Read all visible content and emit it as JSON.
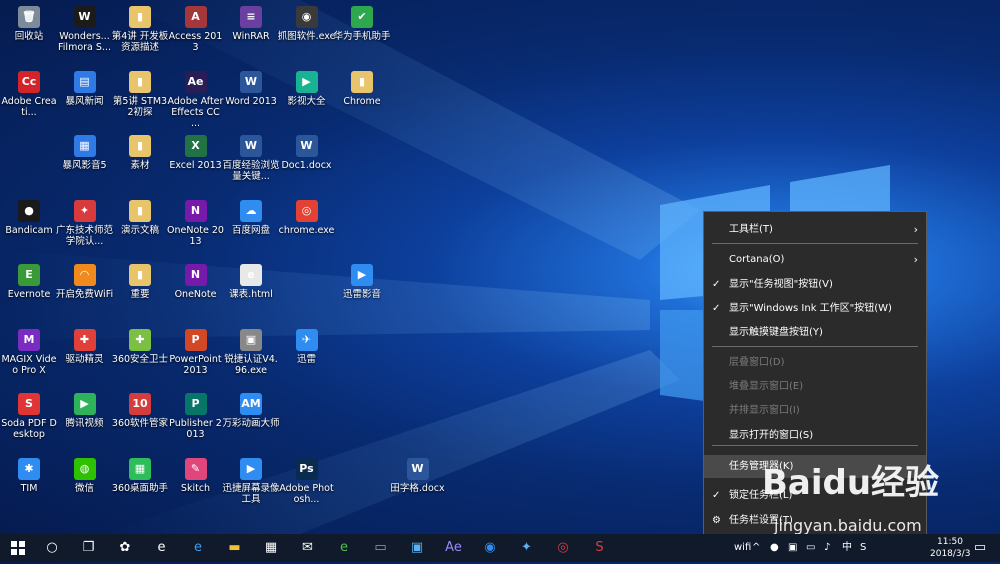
{
  "desktop": {
    "icons": [
      {
        "label": "回收站",
        "glyph": "🗑",
        "color": "#7d8a99"
      },
      {
        "label": "Wonders... Filmora S...",
        "glyph": "W",
        "color": "#1b1b1b"
      },
      {
        "label": "第4讲 开发板资源描述",
        "glyph": "▮",
        "color": "#e8c46a"
      },
      {
        "label": "Access 2013",
        "glyph": "A",
        "color": "#a4373a"
      },
      {
        "label": "WinRAR",
        "glyph": "≡",
        "color": "#6b3fa0"
      },
      {
        "label": "抓图软件.exe",
        "glyph": "◉",
        "color": "#3a3a3a"
      },
      {
        "label": "华为手机助手",
        "glyph": "✔",
        "color": "#2ea84e"
      },
      {
        "label": "Adobe Creati...",
        "glyph": "Cc",
        "color": "#d3242a"
      },
      {
        "label": "暴风新闻",
        "glyph": "▤",
        "color": "#2f7ae5"
      },
      {
        "label": "第5讲 STM32初探",
        "glyph": "▮",
        "color": "#e8c46a"
      },
      {
        "label": "Adobe After Effects CC ...",
        "glyph": "Ae",
        "color": "#2a1d55"
      },
      {
        "label": "Word 2013",
        "glyph": "W",
        "color": "#2b579a"
      },
      {
        "label": "影视大全",
        "glyph": "▶",
        "color": "#19b394"
      },
      {
        "label": "Chrome",
        "glyph": "▮",
        "color": "#e8c46a"
      },
      {
        "label": "暴风影音5",
        "glyph": "▦",
        "color": "#2f7ae5"
      },
      {
        "label": "素材",
        "glyph": "▮",
        "color": "#e8c46a"
      },
      {
        "label": "Excel 2013",
        "glyph": "X",
        "color": "#217346"
      },
      {
        "label": "百度经验浏览量关键...",
        "glyph": "W",
        "color": "#2b579a"
      },
      {
        "label": "Doc1.docx",
        "glyph": "W",
        "color": "#2b579a"
      },
      {
        "label": "Bandicam",
        "glyph": "●",
        "color": "#1a1a1a"
      },
      {
        "label": "广东技术师范学院认...",
        "glyph": "✦",
        "color": "#d83b3b"
      },
      {
        "label": "演示文稿",
        "glyph": "▮",
        "color": "#e8c46a"
      },
      {
        "label": "OneNote 2013",
        "glyph": "N",
        "color": "#7719aa"
      },
      {
        "label": "百度网盘",
        "glyph": "☁",
        "color": "#2f8cf0"
      },
      {
        "label": "chrome.exe",
        "glyph": "◎",
        "color": "#e34133"
      },
      {
        "label": "Evernote",
        "glyph": "E",
        "color": "#3a9a3a"
      },
      {
        "label": "开启免费WiFi",
        "glyph": "◠",
        "color": "#f08a1d"
      },
      {
        "label": "重要",
        "glyph": "▮",
        "color": "#e8c46a"
      },
      {
        "label": "OneNote",
        "glyph": "N",
        "color": "#7719aa"
      },
      {
        "label": "课表.html",
        "glyph": "e",
        "color": "#e8e8e8"
      },
      {
        "label": "迅雷影音",
        "glyph": "▶",
        "color": "#2f8cf0"
      },
      {
        "label": "MAGIX Video Pro X",
        "glyph": "M",
        "color": "#7a2cc1"
      },
      {
        "label": "驱动精灵",
        "glyph": "✚",
        "color": "#e0403a"
      },
      {
        "label": "360安全卫士",
        "glyph": "✚",
        "color": "#7bc043"
      },
      {
        "label": "PowerPoint 2013",
        "glyph": "P",
        "color": "#d24726"
      },
      {
        "label": "锐捷认证V4.96.exe",
        "glyph": "▣",
        "color": "#888888"
      },
      {
        "label": "迅雷",
        "glyph": "✈",
        "color": "#2f8cf0"
      },
      {
        "label": "Soda PDF Desktop",
        "glyph": "S",
        "color": "#e03535"
      },
      {
        "label": "腾讯视频",
        "glyph": "▶",
        "color": "#2fb35a"
      },
      {
        "label": "360软件管家",
        "glyph": "10",
        "color": "#d33d3d"
      },
      {
        "label": "Publisher 2013",
        "glyph": "P",
        "color": "#077568"
      },
      {
        "label": "万彩动画大师",
        "glyph": "AM",
        "color": "#2f8cf0"
      },
      {
        "label": "TIM",
        "glyph": "✱",
        "color": "#2f8cf0"
      },
      {
        "label": "微信",
        "glyph": "◍",
        "color": "#2dc100"
      },
      {
        "label": "360桌面助手",
        "glyph": "▦",
        "color": "#2dbd5a"
      },
      {
        "label": "Skitch",
        "glyph": "✎",
        "color": "#e0457b"
      },
      {
        "label": "迅捷屏幕录像工具",
        "glyph": "▶",
        "color": "#2f8cf0"
      },
      {
        "label": "Adobe Photosh...",
        "glyph": "Ps",
        "color": "#0b2a4f"
      },
      {
        "label": "田字格.docx",
        "glyph": "W",
        "color": "#2b579a"
      }
    ]
  },
  "context_menu": {
    "items": [
      {
        "label": "工具栏(T)",
        "submenu": true,
        "checked": false,
        "disabled": false,
        "highlight": false
      },
      {
        "label": "Cortana(O)",
        "submenu": true,
        "checked": false,
        "disabled": false,
        "highlight": false
      },
      {
        "label": "显示\"任务视图\"按钮(V)",
        "submenu": false,
        "checked": true,
        "disabled": false,
        "highlight": false
      },
      {
        "label": "显示\"Windows Ink 工作区\"按钮(W)",
        "submenu": false,
        "checked": true,
        "disabled": false,
        "highlight": false
      },
      {
        "label": "显示触摸键盘按钮(Y)",
        "submenu": false,
        "checked": false,
        "disabled": false,
        "highlight": false
      },
      {
        "label": "层叠窗口(D)",
        "submenu": false,
        "checked": false,
        "disabled": true,
        "highlight": false
      },
      {
        "label": "堆叠显示窗口(E)",
        "submenu": false,
        "checked": false,
        "disabled": true,
        "highlight": false
      },
      {
        "label": "并排显示窗口(I)",
        "submenu": false,
        "checked": false,
        "disabled": true,
        "highlight": false
      },
      {
        "label": "显示打开的窗口(S)",
        "submenu": false,
        "checked": false,
        "disabled": false,
        "highlight": false
      },
      {
        "label": "任务管理器(K)",
        "submenu": false,
        "checked": false,
        "disabled": false,
        "highlight": true
      },
      {
        "label": "锁定任务栏(L)",
        "submenu": false,
        "checked": true,
        "disabled": false,
        "highlight": false
      },
      {
        "label": "任务栏设置(T)",
        "submenu": false,
        "checked": false,
        "disabled": false,
        "highlight": false,
        "gear": true
      }
    ]
  },
  "taskbar": {
    "start_icon": "windows-logo-icon",
    "pinned": [
      {
        "name": "cortana-circle",
        "glyph": "○",
        "color": "#ffffff"
      },
      {
        "name": "task-view",
        "glyph": "❐",
        "color": "#ffffff"
      },
      {
        "name": "fan-app",
        "glyph": "✿",
        "color": "#ffffff"
      },
      {
        "name": "ie",
        "glyph": "e",
        "color": "#ffffff"
      },
      {
        "name": "edge",
        "glyph": "e",
        "color": "#3a9ff0"
      },
      {
        "name": "file-explorer",
        "glyph": "▬",
        "color": "#f2c230"
      },
      {
        "name": "store",
        "glyph": "▦",
        "color": "#ffffff"
      },
      {
        "name": "mail",
        "glyph": "✉",
        "color": "#ffffff"
      },
      {
        "name": "360-browser",
        "glyph": "e",
        "color": "#4cc24c"
      },
      {
        "name": "laptop-app",
        "glyph": "▭",
        "color": "#5bb0f0"
      },
      {
        "name": "remote-app",
        "glyph": "▣",
        "color": "#5bb0f0"
      },
      {
        "name": "after-effects",
        "glyph": "Ae",
        "color": "#9a88ff"
      },
      {
        "name": "media-player",
        "glyph": "◉",
        "color": "#2f8cf0"
      },
      {
        "name": "bird-app",
        "glyph": "✦",
        "color": "#5bb0f0"
      },
      {
        "name": "netease-music",
        "glyph": "◎",
        "color": "#e23b3b"
      },
      {
        "name": "sohu-app",
        "glyph": "S",
        "color": "#e23b3b"
      }
    ],
    "tray_items": [
      "wifi",
      "^",
      "●",
      "▣",
      "▭",
      "♪",
      "中",
      "S"
    ],
    "time": "11:50",
    "date": "2018/3/3"
  },
  "watermark": {
    "brand": "Baidu经验",
    "url": "jingyan.baidu.com"
  },
  "colors": {
    "menu_bg": "#2b2b2b",
    "menu_highlight": "#4a4a4a",
    "taskbar": "#101a2b"
  }
}
